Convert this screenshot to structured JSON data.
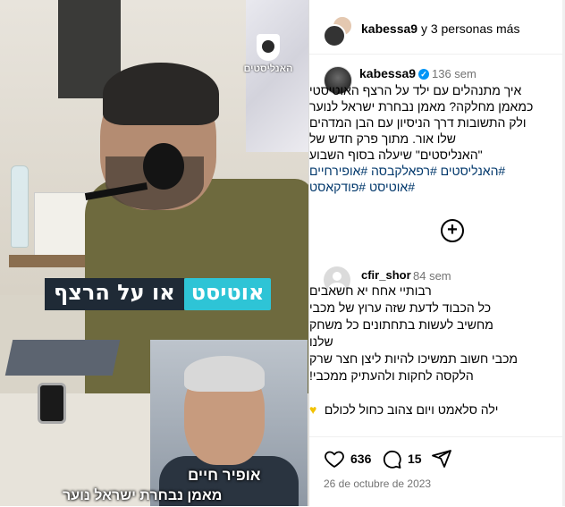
{
  "header": {
    "liked_by_user": "kabessa9",
    "liked_by_rest": " y 3 personas más"
  },
  "post": {
    "username": "kabessa9",
    "time": "136 sem",
    "caption_lines": [
      "איך מתנהלים עם ילד על הרצף האוטיסטי",
      "כמאמן מחלקה? מאמן נבחרת ישראל לנוער",
      "ולק התשובות דרך הניסיון עם הבן המדהים",
      "שלו אור. מתוך פרק חדש של",
      "\"האנליסטים\" שיעלה בסוף השבוע"
    ],
    "hashtag_lines": [
      "#האנליסטים #רפאלקבסה #אופירחיים",
      "#אוטיסט #פודקאסט"
    ]
  },
  "media": {
    "logo_text": "האנליסטים",
    "banner_highlight": "אוטיסט",
    "banner_rest": "או על הרצף",
    "caption_name": "אופיר חיים",
    "caption_title": "מאמן נבחרת ישראל נוער"
  },
  "comment": {
    "username": "cfir_shor",
    "time": "84 sem",
    "lines": [
      "רבותיי אחח יא חשאבים",
      "כל הכבוד לדעת שזה ערוץ של מכבי",
      "מחשיב לעשות בתחתונים כל משחק",
      "שלנו",
      "מכבי חשוב תמשיכו להיות ליצן חצר שרק",
      "הלקסה לחקות ולהעתיק ממכבי!",
      "",
      "ילה סלאמט ויום צהוב כחול לכולם"
    ]
  },
  "actions": {
    "likes": "636",
    "comments": "15",
    "date": "26 de octubre de 2023"
  },
  "icons": {
    "heart": "heart-icon",
    "comment": "comment-icon",
    "share": "share-icon",
    "verified": "verified-badge-icon",
    "add": "add-comments-icon",
    "yellow_heart": "yellow-heart-emoji"
  },
  "colors": {
    "accent": "#0095f6",
    "hashtag": "#00376b",
    "muted": "#737373",
    "banner_highlight": "#2ec4d6",
    "banner_dark": "#1f2a36"
  }
}
